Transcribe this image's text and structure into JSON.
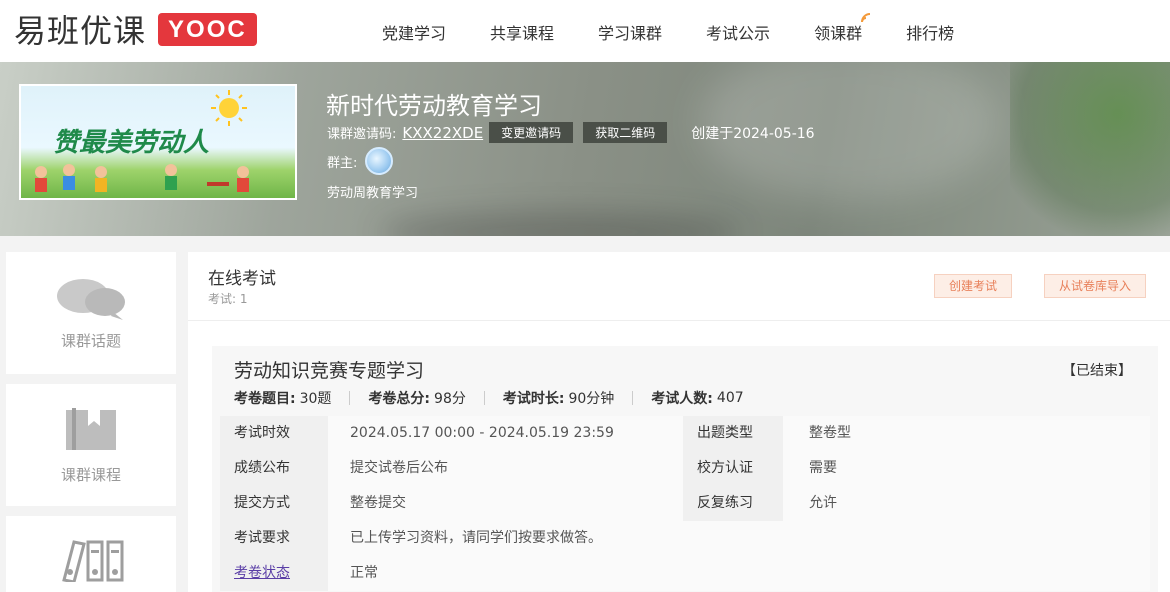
{
  "brand": {
    "name": "易班优课",
    "badge": "YOOC"
  },
  "nav": [
    "党建学习",
    "共享课程",
    "学习课群",
    "考试公示",
    "领课群",
    "排行榜"
  ],
  "course": {
    "cover_text": "赞最美劳动人",
    "title": "新时代劳动教育学习",
    "invite_label": "课群邀请码:",
    "invite_code": "KXX22XDE",
    "change_code_button": "变更邀请码",
    "qr_button": "获取二维码",
    "created": "创建于2024-05-16",
    "owner_label": "群主:",
    "description": "劳动周教育学习"
  },
  "sidebar": [
    {
      "label": "课群话题",
      "icon": "chat-bubbles-icon"
    },
    {
      "label": "课群课程",
      "icon": "book-icon"
    },
    {
      "label": "",
      "icon": "binders-icon"
    }
  ],
  "exam_section": {
    "heading": "在线考试",
    "count_text": "考试: 1",
    "create_button": "创建考试",
    "import_button": "从试卷库导入"
  },
  "exam": {
    "name": "劳动知识竞赛专题学习",
    "status": "【已结束】",
    "stats": [
      {
        "label": "考卷题目:",
        "value": "30题"
      },
      {
        "label": "考卷总分:",
        "value": "98分"
      },
      {
        "label": "考试时长:",
        "value": "90分钟"
      },
      {
        "label": "考试人数:",
        "value": "407"
      }
    ],
    "rows": [
      {
        "k": "考试时效",
        "v": "2024.05.17 00:00 - 2024.05.19 23:59",
        "k2": "出题类型",
        "v2": "整卷型"
      },
      {
        "k": "成绩公布",
        "v": "提交试卷后公布",
        "k2": "校方认证",
        "v2": "需要"
      },
      {
        "k": "提交方式",
        "v": "整卷提交",
        "k2": "反复练习",
        "v2": "允许"
      },
      {
        "k": "考试要求",
        "v": "已上传学习资料，请同学们按要求做答。"
      },
      {
        "k": "考卷状态",
        "v": "正常"
      }
    ]
  },
  "colors": {
    "brand_red": "#e4373d",
    "accent_orange": "#e8805a",
    "link_purple": "#5a3ea6"
  }
}
